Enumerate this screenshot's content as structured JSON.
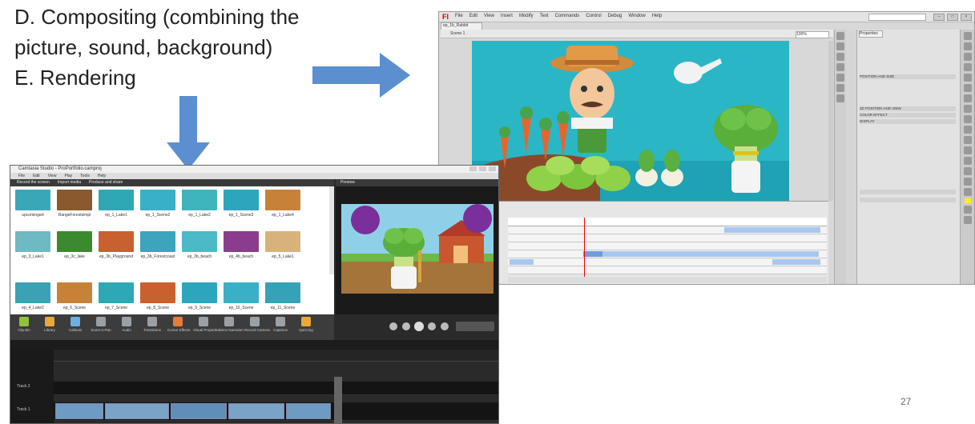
{
  "slide": {
    "lines": [
      "D. Compositing (combining the",
      "picture, sound, background)",
      "E. Rendering"
    ],
    "page_number": "27"
  },
  "arrows": {
    "color": "#5b8fd0"
  },
  "flash_window": {
    "logo": "Fl",
    "menu": [
      "File",
      "Edit",
      "View",
      "Insert",
      "Modify",
      "Text",
      "Commands",
      "Control",
      "Debug",
      "Window",
      "Help"
    ],
    "doc_tab": "ep_1b_Rabbit",
    "scene": "Scene 1",
    "zoom": "100%",
    "props_tab": "Properties",
    "props_rows": [
      "POSITION AND SIZE",
      "3D POSITION AND VIEW",
      "COLOR EFFECT",
      "DISPLAY"
    ],
    "stage_color": "#2bb6c6"
  },
  "camtasia_window": {
    "title": "Camtasia Studio - ProPortfolio.camproj",
    "menu": [
      "File",
      "Edit",
      "View",
      "Play",
      "Tools",
      "Help"
    ],
    "lib_tabs": [
      "Record the screen",
      "Import media",
      "Produce and share"
    ],
    "preview_tab": "Preview",
    "library_items": [
      {
        "label": "upcomingart",
        "color": "#3aa7b8"
      },
      {
        "label": "RangeForestsimpl",
        "color": "#8a5a2e"
      },
      {
        "label": "ep_1_Lake1",
        "color": "#2fa8b5"
      },
      {
        "label": "ep_1_Scene2",
        "color": "#3ab0c6"
      },
      {
        "label": "ep_1_Lake2",
        "color": "#3eb4bc"
      },
      {
        "label": "ep_1_Scene3",
        "color": "#2ca5bd"
      },
      {
        "label": "ep_1_Lake4",
        "color": "#c7823a"
      },
      {
        "label": "ep_3_Lake1",
        "color": "#6fb9c2"
      },
      {
        "label": "ep_3c_lake",
        "color": "#3b8a2f"
      },
      {
        "label": "ep_3b_Playground",
        "color": "#c8612f"
      },
      {
        "label": "ep_3b_Forestcoast",
        "color": "#3ca5bd"
      },
      {
        "label": "ep_3b_beach",
        "color": "#4bbac6"
      },
      {
        "label": "ep_4b_beach",
        "color": "#8a3d8e"
      },
      {
        "label": "ep_5_Lake1",
        "color": "#d6b37a"
      },
      {
        "label": "ep_4_Lake2",
        "color": "#3ba2b4"
      },
      {
        "label": "ep_6_Scene",
        "color": "#c7823a"
      },
      {
        "label": "ep_7_Scene",
        "color": "#2fa8b5"
      },
      {
        "label": "ep_8_Scene",
        "color": "#c8612f"
      },
      {
        "label": "ep_9_Scene",
        "color": "#2ca5bd"
      },
      {
        "label": "ep_10_Scene",
        "color": "#3ab0c6"
      },
      {
        "label": "ep_11_Scene",
        "color": "#36a2b7"
      }
    ],
    "tools": [
      {
        "label": "Clip Bin",
        "color": "#8fc33a"
      },
      {
        "label": "Library",
        "color": "#e8a93a"
      },
      {
        "label": "Callouts",
        "color": "#6ab0e0"
      },
      {
        "label": "Zoom-n-Pan",
        "color": "#9aa0a6"
      },
      {
        "label": "Audio",
        "color": "#9aa0a6"
      },
      {
        "label": "Transitions",
        "color": "#9aa0a6"
      },
      {
        "label": "Cursor Effects",
        "color": "#e87b3a"
      },
      {
        "label": "Visual Properties",
        "color": "#9aa0a6"
      },
      {
        "label": "Voice Narration",
        "color": "#9aa0a6"
      },
      {
        "label": "Record Camera",
        "color": "#9aa0a6"
      },
      {
        "label": "Captions",
        "color": "#9aa0a6"
      },
      {
        "label": "Quizzing",
        "color": "#e8a93a"
      }
    ],
    "tracks": [
      "Track 2",
      "Track 1"
    ]
  }
}
